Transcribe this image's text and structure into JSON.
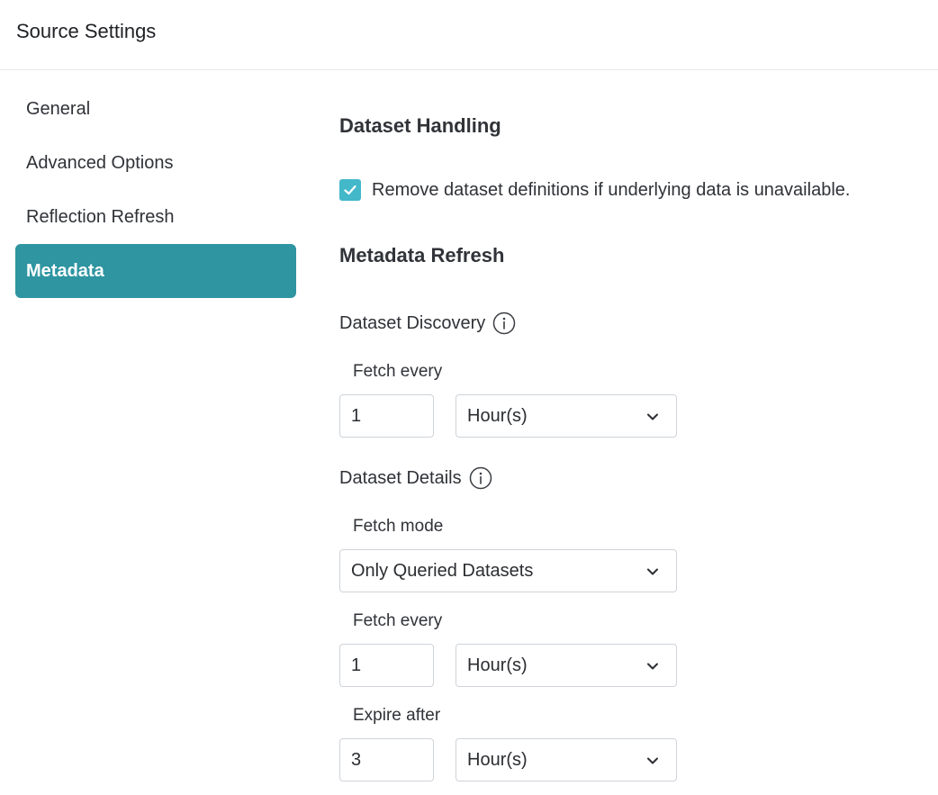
{
  "header": {
    "title": "Source Settings"
  },
  "sidebar": {
    "items": [
      {
        "label": "General"
      },
      {
        "label": "Advanced Options"
      },
      {
        "label": "Reflection Refresh"
      },
      {
        "label": "Metadata"
      }
    ],
    "active": "Metadata"
  },
  "dataset_handling": {
    "title": "Dataset Handling",
    "remove_definitions": {
      "label": "Remove dataset definitions if underlying data is unavailable.",
      "checked": true
    }
  },
  "metadata_refresh": {
    "title": "Metadata Refresh",
    "discovery": {
      "title": "Dataset Discovery",
      "fetch_every_label": "Fetch every",
      "fetch_every_value": "1",
      "fetch_every_unit": "Hour(s)"
    },
    "details": {
      "title": "Dataset Details",
      "fetch_mode_label": "Fetch mode",
      "fetch_mode_value": "Only Queried Datasets",
      "fetch_every_label": "Fetch every",
      "fetch_every_value": "1",
      "fetch_every_unit": "Hour(s)",
      "expire_after_label": "Expire after",
      "expire_after_value": "3",
      "expire_after_unit": "Hour(s)"
    }
  },
  "colors": {
    "accent": "#2e95a1",
    "checkbox": "#43b8c9",
    "border": "#cfd3d8"
  }
}
